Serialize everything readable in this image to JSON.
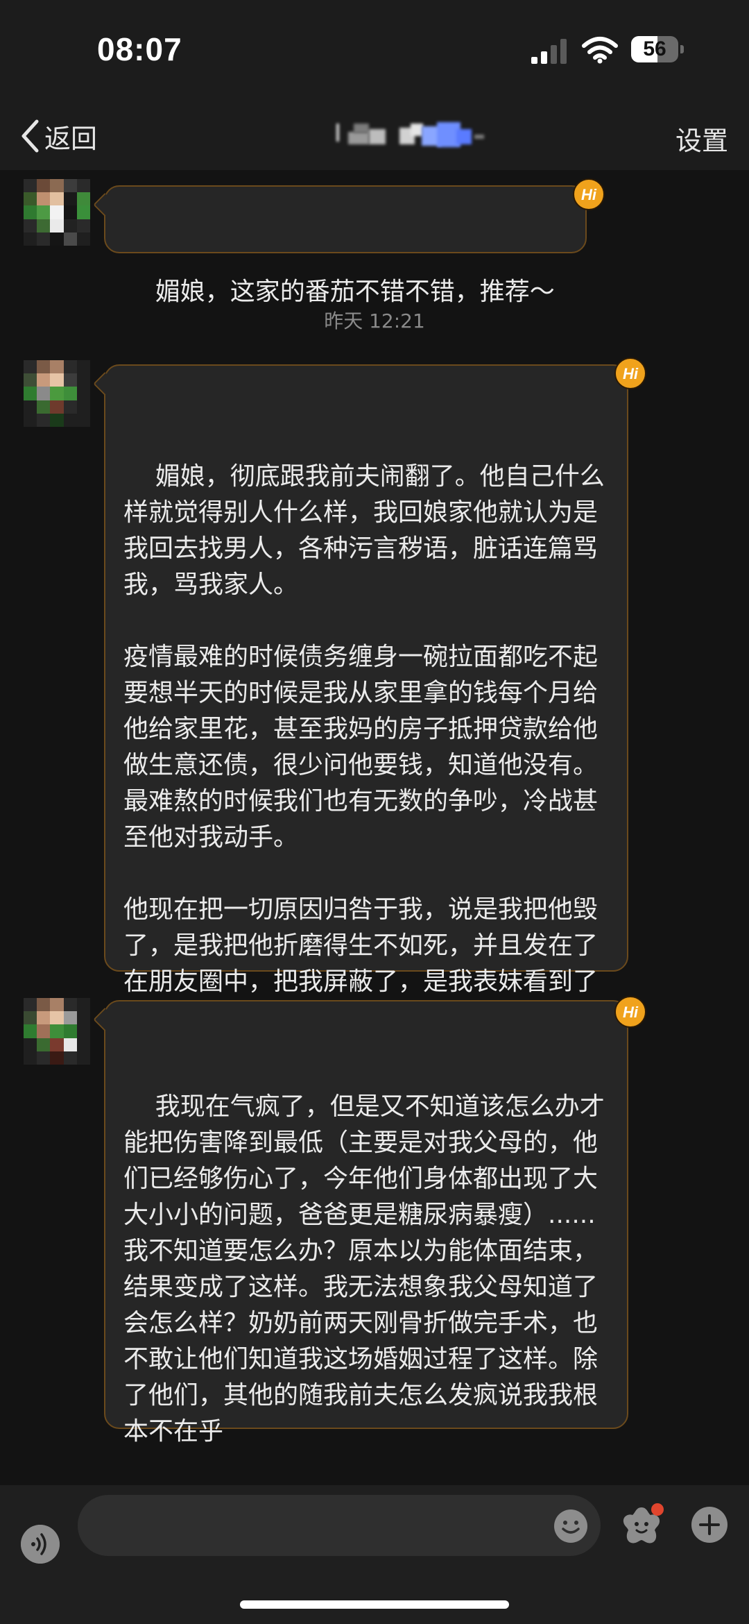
{
  "status_bar": {
    "time": "08:07",
    "battery_label": "56",
    "battery_level": 0.56
  },
  "nav": {
    "back_label": "返回",
    "settings_label": "设置"
  },
  "chat": {
    "timestamp": "昨天 12:21",
    "messages": [
      {
        "text": "媚娘，这家的番茄不错不错，推荐～"
      },
      {
        "text": "媚娘，彻底跟我前夫闹翻了。他自己什么样就觉得别人什么样，我回娘家他就认为是我回去找男人，各种污言秽语，脏话连篇骂我，骂我家人。\n\n疫情最难的时候债务缠身一碗拉面都吃不起要想半天的时候是我从家里拿的钱每个月给他给家里花，甚至我妈的房子抵押贷款给他做生意还债，很少问他要钱，知道他没有。最难熬的时候我们也有无数的争吵，冷战甚至他对我动手。\n\n他现在把一切原因归咎于我，说是我把他毁了，是我把他折磨得生不如死，并且发在了在朋友圈中，把我屏蔽了，是我表妹看到了然后截图发给我看的。"
      },
      {
        "text": "我现在气疯了，但是又不知道该怎么办才能把伤害降到最低（主要是对我父母的，他们已经够伤心了，今年他们身体都出现了大大小小的问题，爸爸更是糖尿病暴瘦）......我不知道要怎么办？原本以为能体面结束，结果变成了这样。我无法想象我父母知道了会怎么样？奶奶前两天刚骨折做完手术，也不敢让他们知道我这场婚姻过程了这样。除了他们，其他的随我前夫怎么发疯说我我根本不在乎"
      }
    ]
  },
  "input_bar": {
    "value": "",
    "placeholder": ""
  },
  "colors": {
    "background": "#131313",
    "bar_background": "#1c1c1c",
    "bubble_background": "#262626",
    "bubble_border": "#6b4a1c",
    "hi_badge": "#f0a21c",
    "notification_dot": "#e0452e"
  },
  "icons": [
    "back-chevron-icon",
    "signal-icon",
    "wifi-icon",
    "battery-icon",
    "hi-badge-icon",
    "voice-icon",
    "emoji-icon",
    "sticker-icon",
    "plus-icon"
  ]
}
